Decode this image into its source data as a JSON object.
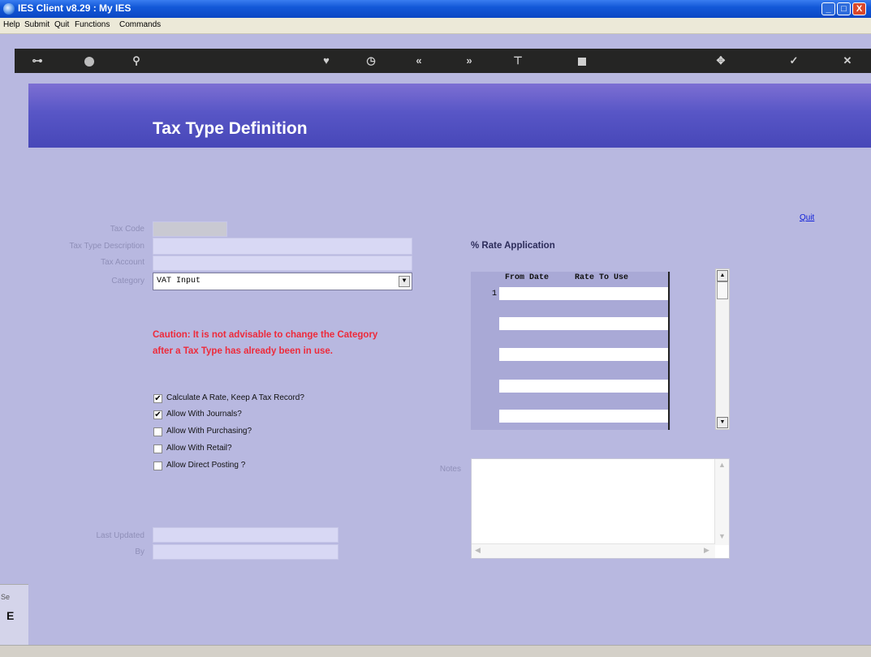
{
  "window": {
    "title": "IES Client v8.29 : My IES",
    "min_symbol": "_",
    "max_symbol": "□",
    "close_symbol": "X"
  },
  "menu": [
    "Help",
    "Submit",
    "Quit",
    "Functions",
    "Commands"
  ],
  "toolbar": {
    "items": [
      {
        "name": "key-icon",
        "glyph": "⊶"
      },
      {
        "name": "help-icon",
        "glyph": "?"
      },
      {
        "name": "search-icon",
        "glyph": "🔍"
      },
      {
        "name": "heart-icon",
        "glyph": "♥"
      },
      {
        "name": "clock-icon",
        "glyph": "◷"
      },
      {
        "name": "prev-icon",
        "glyph": "«"
      },
      {
        "name": "next-icon",
        "glyph": "»"
      },
      {
        "name": "tree-icon",
        "glyph": "⊤"
      },
      {
        "name": "stop-icon",
        "glyph": "■"
      },
      {
        "name": "nav-icon",
        "glyph": "✥"
      },
      {
        "name": "check-icon",
        "glyph": "✓"
      },
      {
        "name": "cancel-icon",
        "glyph": "✕"
      }
    ]
  },
  "header": {
    "title": "Tax Type Definition"
  },
  "quit_link": "Quit",
  "form": {
    "tax_code_label": "Tax Code",
    "tax_code_value": "",
    "description_label": "Tax Type Description",
    "description_value": "",
    "account_label": "Tax Account",
    "account_value": "",
    "category_label": "Category",
    "category_value": "VAT Input",
    "last_updated_label": "Last Updated",
    "last_updated_value": "",
    "by_label": "By",
    "by_value": ""
  },
  "caution": "Caution: It is not advisable to change the Category after a Tax Type has already been in use.",
  "checkboxes": [
    {
      "label": "Calculate A Rate, Keep A Tax Record?",
      "checked": "✔"
    },
    {
      "label": "Allow With Journals?",
      "checked": "✔"
    },
    {
      "label": "Allow With Purchasing?",
      "checked": ""
    },
    {
      "label": "Allow With Retail?",
      "checked": ""
    },
    {
      "label": "Allow Direct Posting ?",
      "checked": ""
    }
  ],
  "rate_application": {
    "title": "% Rate Application",
    "columns": [
      "From Date",
      "Rate To Use"
    ],
    "row_number": "1"
  },
  "notes": {
    "label": "Notes",
    "value": ""
  },
  "left_stub": {
    "text1": "Se",
    "text2": "E"
  }
}
